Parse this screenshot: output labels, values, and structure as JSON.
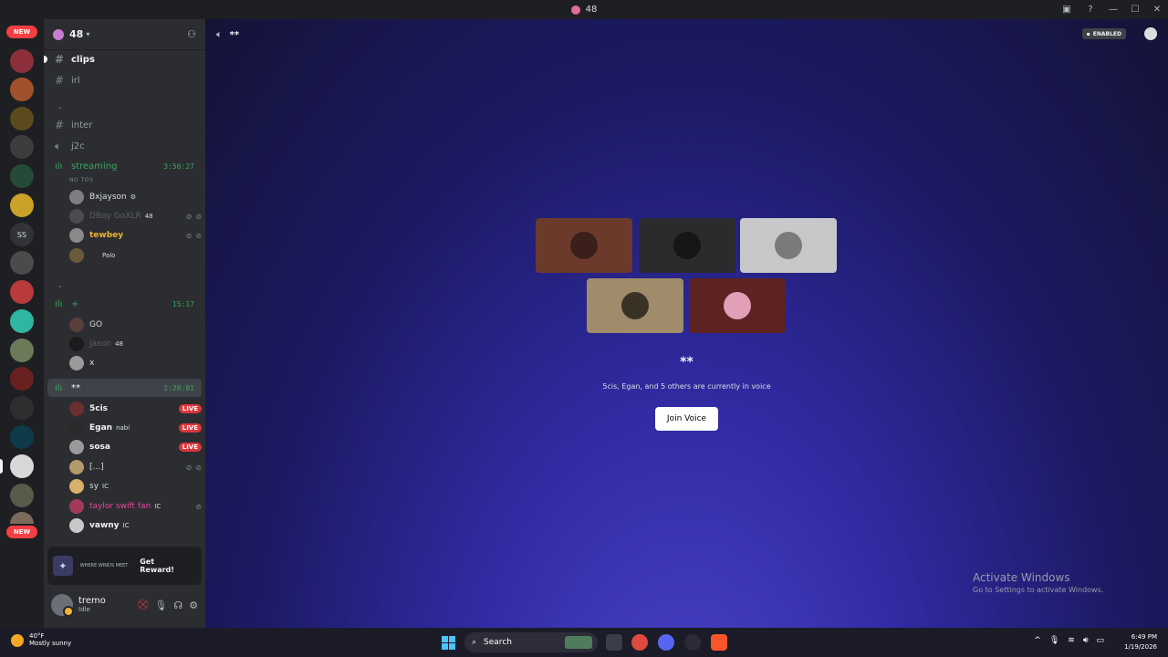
{
  "titlebar": {
    "title": "48"
  },
  "rail": {
    "new_top": "NEW",
    "new_bottom": "NEW",
    "text_server": "SS"
  },
  "guild": {
    "name": "48"
  },
  "channels": {
    "clips": "clips",
    "irl": "irl",
    "inter": "inter",
    "j2c": "j2c",
    "streaming": {
      "name": "streaming",
      "timer": "3:56:27",
      "subtitle": "NO TOS"
    },
    "plus": {
      "name": "+",
      "timer": "15:17"
    },
    "stars": {
      "name": "**",
      "timer": "1:28:01"
    }
  },
  "streaming_users": [
    {
      "name": "Bxjayson"
    },
    {
      "name": "DBoy GoXLR",
      "tag": "48"
    },
    {
      "name": "tewbey"
    },
    {
      "name": "Palo"
    }
  ],
  "plus_users": [
    {
      "name": "GO"
    },
    {
      "name": "Jason",
      "tag": "48"
    },
    {
      "name": "x"
    }
  ],
  "stars_users": [
    {
      "name": "5cis",
      "live": "LIVE"
    },
    {
      "name": "Egan",
      "tag": "nabi",
      "live": "LIVE"
    },
    {
      "name": "sosa",
      "live": "LIVE"
    },
    {
      "name": "[...]"
    },
    {
      "name": "sy",
      "tag": "IC"
    },
    {
      "name": "taylor swift fan",
      "tag": "IC"
    },
    {
      "name": "vawny",
      "tag": "IC"
    }
  ],
  "promo": {
    "brand": "WHERE WINDS MEET",
    "button": "Get Reward!"
  },
  "me": {
    "name": "tremo",
    "status": "Idle"
  },
  "main": {
    "channel_name": "**",
    "enabled": "ENABLED",
    "title": "**",
    "description": "5cis, Egan, and 5 others are currently in voice",
    "join": "Join Voice"
  },
  "activate": {
    "line1": "Activate Windows",
    "line2": "Go to Settings to activate Windows."
  },
  "taskbar": {
    "temp": "40°F",
    "condition": "Mostly sunny",
    "search": "Search",
    "time": "6:49 PM",
    "date": "1/19/2026"
  },
  "colors": {
    "accent": "#5865f2",
    "live": "#da373c",
    "voice_green": "#3ba55d",
    "main_bg": "#2f2aa0"
  }
}
